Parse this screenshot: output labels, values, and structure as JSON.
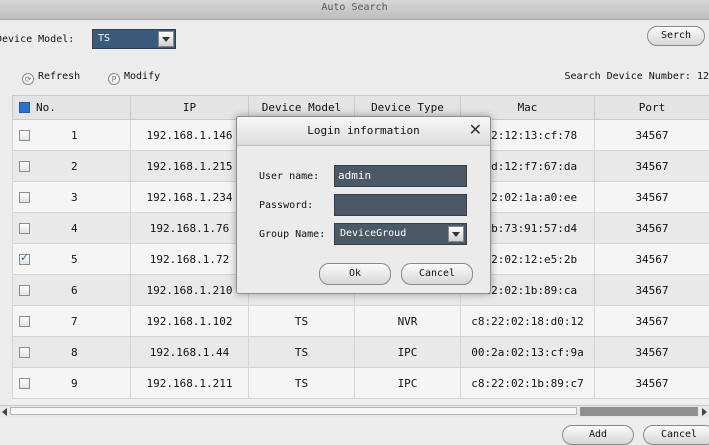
{
  "window": {
    "title": "Auto Search"
  },
  "toolbar": {
    "device_model_label": "Device Model:",
    "device_model_value": "TS",
    "search_button": "Serch",
    "refresh_label": "Refresh",
    "modify_label": "Modify",
    "search_device_number_label": "Search Device Number:",
    "search_device_number_value": "12"
  },
  "table": {
    "columns": [
      "No.",
      "IP",
      "Device Model",
      "Device Type",
      "Mac",
      "Port"
    ],
    "rows": [
      {
        "checked": false,
        "no": "1",
        "ip": "192.168.1.146",
        "model": "",
        "type": "",
        "mac": ":22:12:13:cf:78",
        "port": "34567"
      },
      {
        "checked": false,
        "no": "2",
        "ip": "192.168.1.215",
        "model": "",
        "type": "",
        "mac": ":cd:12:f7:67:da",
        "port": "34567"
      },
      {
        "checked": false,
        "no": "3",
        "ip": "192.168.1.234",
        "model": "",
        "type": "",
        "mac": ":22:02:1a:a0:ee",
        "port": "34567"
      },
      {
        "checked": false,
        "no": "4",
        "ip": "192.168.1.76",
        "model": "",
        "type": "",
        "mac": ":5b:73:91:57:d4",
        "port": "34567"
      },
      {
        "checked": true,
        "no": "5",
        "ip": "192.168.1.72",
        "model": "",
        "type": "",
        "mac": ":22:02:12:e5:2b",
        "port": "34567"
      },
      {
        "checked": false,
        "no": "6",
        "ip": "192.168.1.210",
        "model": "",
        "type": "",
        "mac": ":22:02:1b:89:ca",
        "port": "34567"
      },
      {
        "checked": false,
        "no": "7",
        "ip": "192.168.1.102",
        "model": "TS",
        "type": "NVR",
        "mac": "c8:22:02:18:d0:12",
        "port": "34567"
      },
      {
        "checked": false,
        "no": "8",
        "ip": "192.168.1.44",
        "model": "TS",
        "type": "IPC",
        "mac": "00:2a:02:13:cf:9a",
        "port": "34567"
      },
      {
        "checked": false,
        "no": "9",
        "ip": "192.168.1.211",
        "model": "TS",
        "type": "IPC",
        "mac": "c8:22:02:1b:89:c7",
        "port": "34567"
      }
    ]
  },
  "footer": {
    "add_button": "Add",
    "cancel_button": "Cancel"
  },
  "dialog": {
    "title": "Login information",
    "username_label": "User name:",
    "username_value": "admin",
    "password_label": "Password:",
    "password_value": "",
    "group_label": "Group Name:",
    "group_value": "DeviceGroud",
    "ok_button": "Ok",
    "cancel_button": "Cancel"
  },
  "colors": {
    "accent": "#2b72d0",
    "input_bg": "#4b5966",
    "select_bg": "#3b5a7a"
  }
}
